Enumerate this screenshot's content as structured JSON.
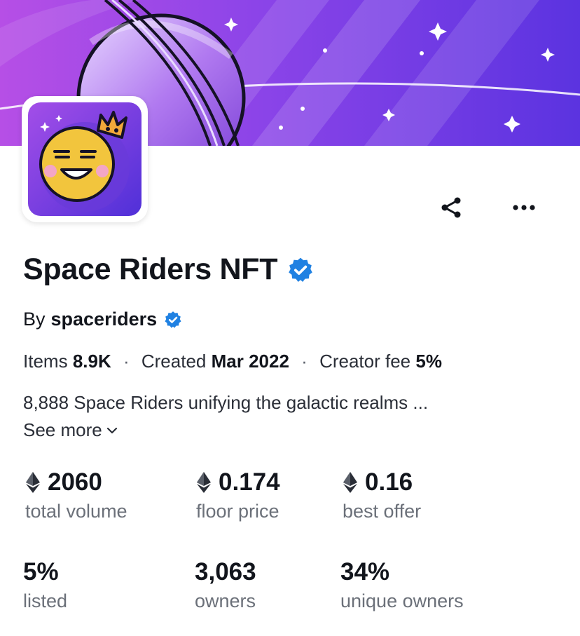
{
  "collection": {
    "name": "Space Riders NFT",
    "verified": true,
    "by_prefix": "By",
    "creator": "spaceriders",
    "creator_verified": true
  },
  "actions": {
    "share_icon": "share-icon",
    "more_icon": "more-dots-icon"
  },
  "meta": {
    "items_label": "Items",
    "items_value": "8.9K",
    "separator": "·",
    "created_label": "Created",
    "created_value": "Mar 2022",
    "fee_label": "Creator fee",
    "fee_value": "5%"
  },
  "description": {
    "text": "8,888 Space Riders unifying the galactic realms ...",
    "see_more": "See more"
  },
  "stats": [
    {
      "value": "2060",
      "label": "total volume",
      "eth": true
    },
    {
      "value": "0.174",
      "label": "floor price",
      "eth": true
    },
    {
      "value": "0.16",
      "label": "best offer",
      "eth": true
    },
    {
      "value": "5%",
      "label": "listed",
      "eth": false
    },
    {
      "value": "3,063",
      "label": "owners",
      "eth": false
    },
    {
      "value": "34%",
      "label": "unique owners",
      "eth": false
    }
  ],
  "colors": {
    "verified_blue": "#2081e2",
    "banner_purple": "#7b3fe4",
    "banner_magenta": "#b14be6",
    "avatar_face": "#f2c53d"
  }
}
